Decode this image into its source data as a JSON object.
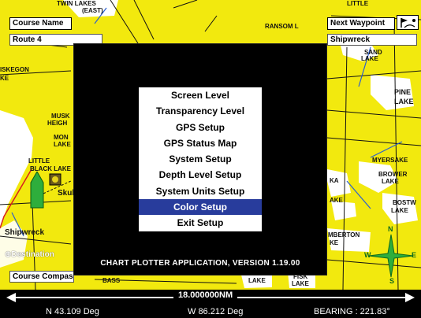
{
  "top_left": {
    "label": "Course Name",
    "value": "Route 4"
  },
  "top_right": {
    "label": "Next Waypoint",
    "value": "Shipwreck",
    "icon": "waypoint-flag-icon"
  },
  "bottom_left": {
    "destination_label": "Destination",
    "course_compass_label": "Course Compass"
  },
  "map_labels": {
    "twin_lakes": "TWIN LAKES",
    "east": "(EAST)",
    "ransom": "RANSOM L",
    "little": "LITTLE",
    "sand_lake": "SAND",
    "sand_lake2": "LAKE",
    "pine": "PINE",
    "pine2": "LAKE",
    "iskegon": "ISKEGON",
    "ke": "KE",
    "musk": "MUSK",
    "heigh": "HEIGH",
    "mon": "MON",
    "lake_l": "LAKE",
    "little_black": "LITTLE",
    "black_lake": "BLACK LAKE",
    "skul": "Skul",
    "shipwreck": "Shipwreck",
    "myersake": "MYERSAKE",
    "brower": "BROWER",
    "brower_lake": "LAKE",
    "bostwick": "BOSTW",
    "bostwick_lake": "LAKE",
    "kake": "AKE",
    "ka": "KA",
    "mberton": "MBERTON",
    "ke2": "KE",
    "lake_b": "LAKE",
    "fish": "FISK",
    "fish_lake": "LAKE",
    "bass": "BASS",
    "n": "N",
    "w": "W",
    "e": "E",
    "s": "S"
  },
  "menu": {
    "items": [
      "Screen Level",
      "Transparency Level",
      "GPS Setup",
      "GPS Status Map",
      "System Setup",
      "Depth Level Setup",
      "System Units Setup",
      "Color Setup",
      "Exit Setup"
    ],
    "selected_index": 7
  },
  "version_text": "CHART PLOTTER APPLICATION, VERSION 1.19.00",
  "scale": "18.000000NM",
  "status": {
    "lat": "N 43.109 Deg",
    "lon": "W 86.212 Deg",
    "bearing": "BEARING : 221.83°"
  },
  "colors": {
    "land": "#f2e90e",
    "water": "#ffffff",
    "selected": "#283c9c",
    "vessel": "#2eae3c",
    "compass": "#2eae3c"
  }
}
